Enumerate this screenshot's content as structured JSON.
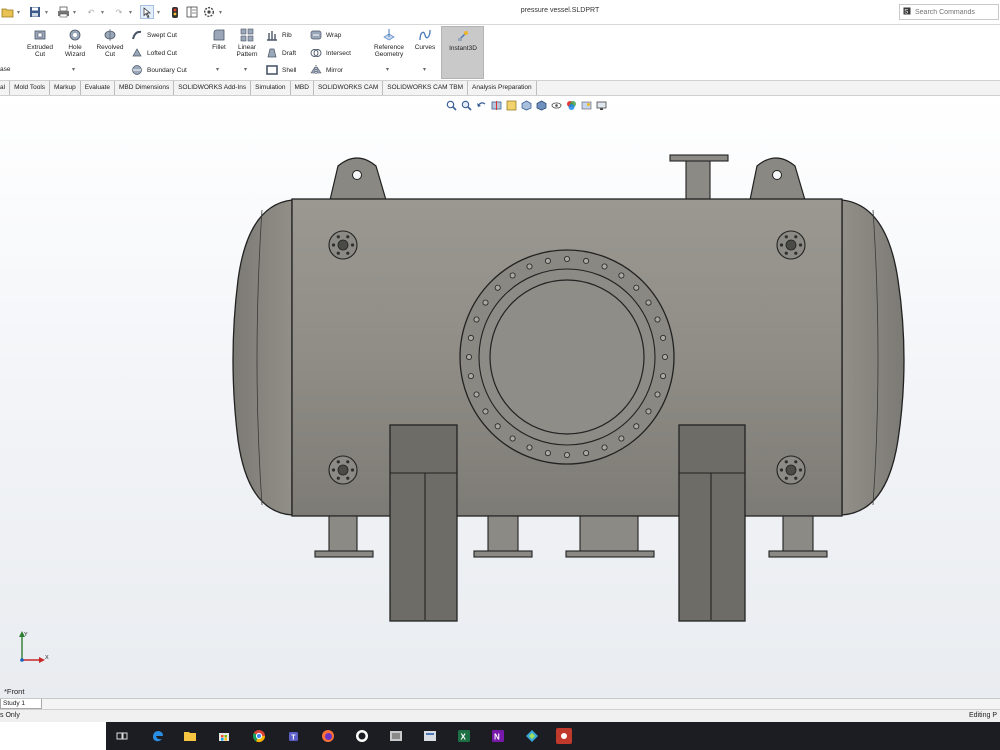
{
  "window": {
    "title": "pressure vessel.SLDPRT",
    "search_placeholder": "Search Commands"
  },
  "ribbon": {
    "extruded_cut": "Extruded Cut",
    "hole_wizard": "Hole Wizard",
    "revolved_cut": "Revolved Cut",
    "swept_cut": "Swept Cut",
    "lofted_cut": "Lofted Cut",
    "boundary_cut": "Boundary Cut",
    "fillet": "Fillet",
    "linear_pattern": "Linear Pattern",
    "rib": "Rib",
    "draft": "Draft",
    "shell": "Shell",
    "wrap": "Wrap",
    "intersect": "Intersect",
    "mirror": "Mirror",
    "reference_geometry": "Reference Geometry",
    "curves": "Curves",
    "instant3d": "Instant3D",
    "left_cut_text": "ase"
  },
  "tabs": [
    "al",
    "Mold Tools",
    "Markup",
    "Evaluate",
    "MBD Dimensions",
    "SOLIDWORKS Add-Ins",
    "Simulation",
    "MBD",
    "SOLIDWORKS CAM",
    "SOLIDWORKS CAM TBM",
    "Analysis Preparation"
  ],
  "viewport": {
    "view_name": "*Front",
    "triad_x": "X",
    "triad_y": "Y"
  },
  "bottom": {
    "model_tab": "Study 1",
    "status_left": "s Only",
    "status_right": "Editing P"
  },
  "colors": {
    "vessel_body": "#8f8d86",
    "vessel_shadow": "#6e6c66",
    "accent_blue": "#2a6fc9",
    "taskbar": "#1c1d22"
  },
  "icons": {
    "hud": [
      "zoom-to-fit-icon",
      "zoom-area-icon",
      "previous-view-icon",
      "section-view-icon",
      "dynamic-annotation-icon",
      "view-orientation-icon",
      "display-style-icon",
      "hide-show-icon",
      "edit-appearance-icon",
      "apply-scene-icon",
      "view-settings-icon"
    ],
    "taskbar": [
      "task-view-icon",
      "edge-icon",
      "file-explorer-icon",
      "store-icon",
      "chrome-icon",
      "teams-icon",
      "firefox-icon",
      "github-icon",
      "solidworks-icon",
      "app-icon",
      "excel-icon",
      "onenote-icon",
      "app-icon",
      "recorder-icon"
    ]
  }
}
